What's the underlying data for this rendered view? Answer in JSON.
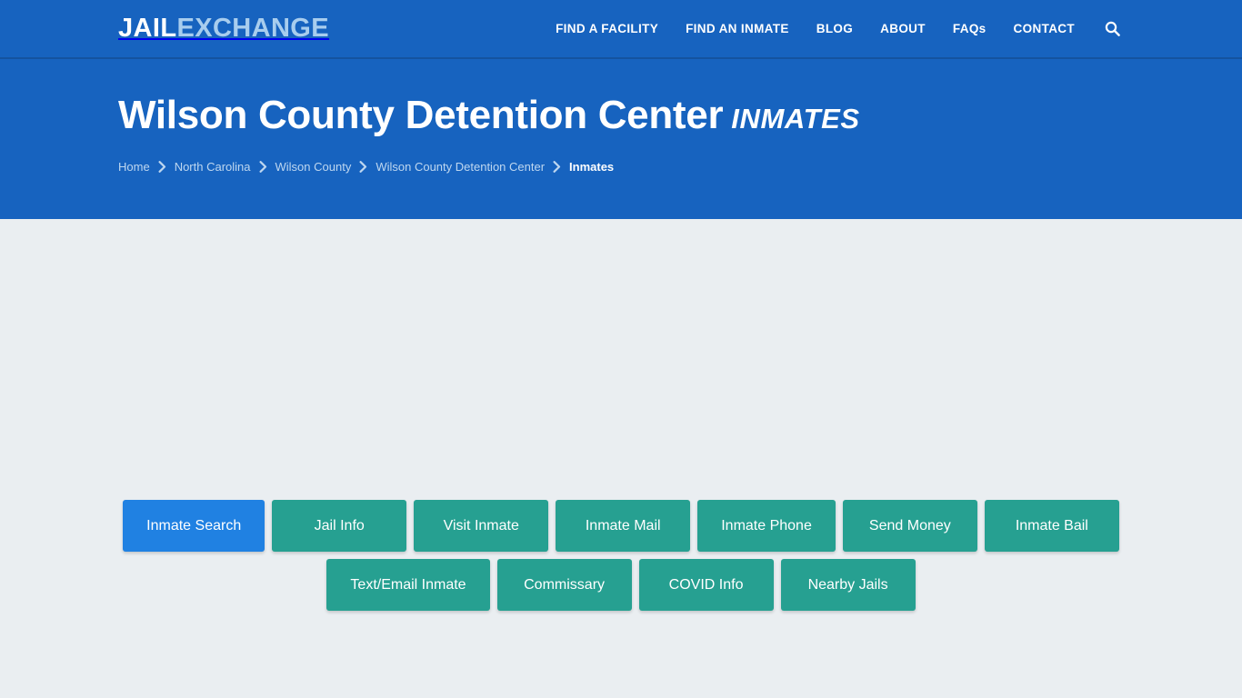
{
  "navbar": {
    "logo_primary": "JAIL",
    "logo_secondary": "EXCHANGE",
    "links": [
      {
        "label": "FIND A FACILITY"
      },
      {
        "label": "FIND AN INMATE"
      },
      {
        "label": "BLOG"
      },
      {
        "label": "ABOUT"
      },
      {
        "label": "FAQs"
      },
      {
        "label": "CONTACT"
      }
    ],
    "search_icon": "search-icon",
    "background_color": "#1763bf"
  },
  "hero": {
    "title": "Wilson County Detention Center",
    "title_suffix": "INMATES",
    "background_color": "#1763bf",
    "breadcrumb": [
      {
        "label": "Home",
        "current": false
      },
      {
        "label": "North Carolina",
        "current": false
      },
      {
        "label": "Wilson County",
        "current": false
      },
      {
        "label": "Wilson County Detention Center",
        "current": false
      },
      {
        "label": "Inmates",
        "current": true
      }
    ],
    "breadcrumb_separator_icon": "chevron-right-icon"
  },
  "main": {
    "background_color": "#eaeef1",
    "button_rows": [
      {
        "buttons": [
          {
            "label": "Inmate Search",
            "active": true,
            "name": "inmate-search-button"
          },
          {
            "label": "Jail Info",
            "active": false,
            "name": "jail-info-button"
          },
          {
            "label": "Visit Inmate",
            "active": false,
            "name": "visit-inmate-button"
          },
          {
            "label": "Inmate Mail",
            "active": false,
            "name": "inmate-mail-button"
          },
          {
            "label": "Inmate Phone",
            "active": false,
            "name": "inmate-phone-button"
          },
          {
            "label": "Send Money",
            "active": false,
            "name": "send-money-button"
          },
          {
            "label": "Inmate Bail",
            "active": false,
            "name": "inmate-bail-button"
          }
        ]
      },
      {
        "buttons": [
          {
            "label": "Text/Email Inmate",
            "active": false,
            "name": "text-email-inmate-button"
          },
          {
            "label": "Commissary",
            "active": false,
            "name": "commissary-button"
          },
          {
            "label": "COVID Info",
            "active": false,
            "name": "covid-info-button"
          },
          {
            "label": "Nearby Jails",
            "active": false,
            "name": "nearby-jails-button"
          }
        ]
      }
    ],
    "active_button_color": "#2081e2",
    "button_color": "#26a091"
  }
}
